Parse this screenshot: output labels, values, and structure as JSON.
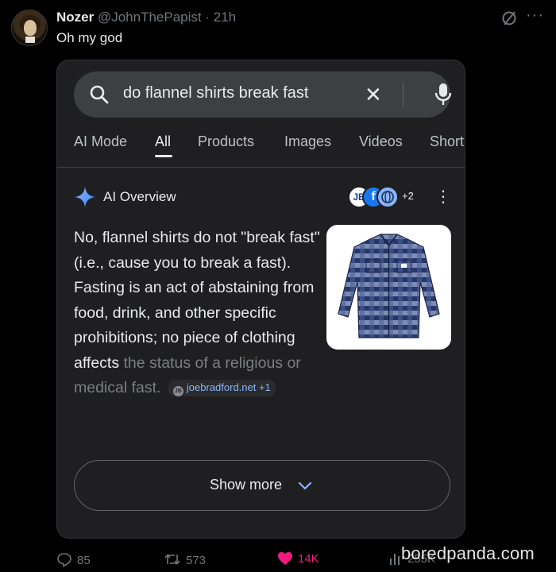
{
  "tweet": {
    "name": "Nozer",
    "handle": "@JohnThePapist",
    "time": "· 21h",
    "text": "Oh my god"
  },
  "search": {
    "query": "do flannel shirts break fast"
  },
  "tabs": [
    "AI Mode",
    "All",
    "Products",
    "Images",
    "Videos",
    "Short"
  ],
  "active_tab": "All",
  "ai_overview": {
    "label": "AI Overview",
    "source_count": "+2",
    "answer_main": "No, flannel shirts do not \"break fast\" (i.e., cause you to break a fast). Fasting is an act of abstaining from food, drink, and other specific prohibitions; no piece of clothing affects",
    "answer_faded_1": "the status of a religious or medical",
    "answer_faded_2": "fast.",
    "citation": "joebradford.net +1",
    "citation_icon": "JB",
    "source_badge_1": "JB",
    "source_badge_2": "f"
  },
  "show_more": "Show more",
  "actions": {
    "replies": "85",
    "reposts": "573",
    "likes": "14K",
    "views": "255K"
  },
  "watermark": "boredpanda.com",
  "colors": {
    "like": "#f91880",
    "muted": "#71767b",
    "card_bg": "#1f1f21",
    "link": "#8ab4f8"
  }
}
